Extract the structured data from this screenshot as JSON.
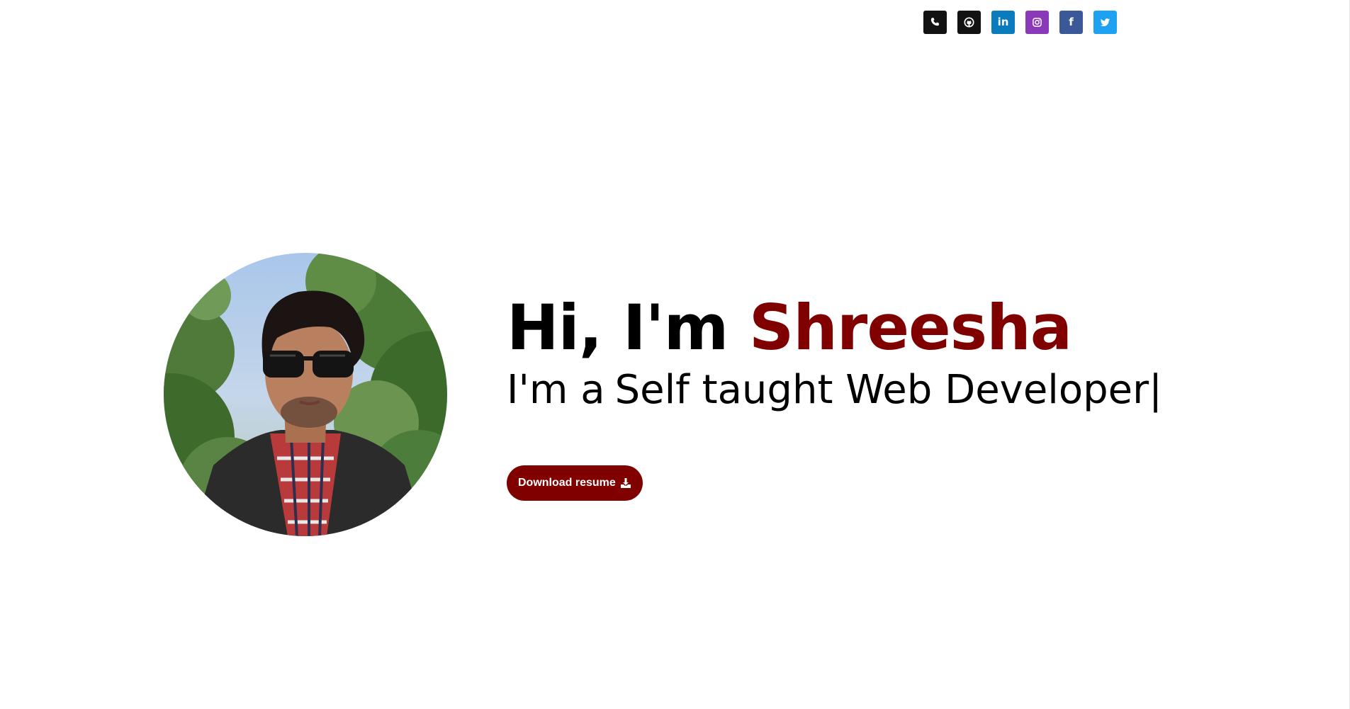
{
  "social": [
    {
      "name": "phone",
      "icon": "phone-icon",
      "color": "#121212"
    },
    {
      "name": "github",
      "icon": "github-icon",
      "color": "#121212"
    },
    {
      "name": "linkedin",
      "icon": "linkedin-icon",
      "label": "in",
      "color": "#0a7bbd"
    },
    {
      "name": "instagram",
      "icon": "instagram-icon",
      "color": "#8a3ab9"
    },
    {
      "name": "facebook",
      "icon": "facebook-icon",
      "label": "f",
      "color": "#3b5998"
    },
    {
      "name": "twitter",
      "icon": "twitter-icon",
      "color": "#1da1f2"
    }
  ],
  "hero": {
    "greeting_prefix": "Hi, I'm ",
    "name": "Shreesha",
    "tagline_prefix": "I'm a",
    "tagline_typed": "Self taught Web Developer",
    "cursor": "|"
  },
  "resume_button": {
    "label": "Download resume",
    "icon": "download-icon"
  },
  "colors": {
    "accent": "#800000",
    "text": "#000000",
    "background": "#ffffff"
  }
}
